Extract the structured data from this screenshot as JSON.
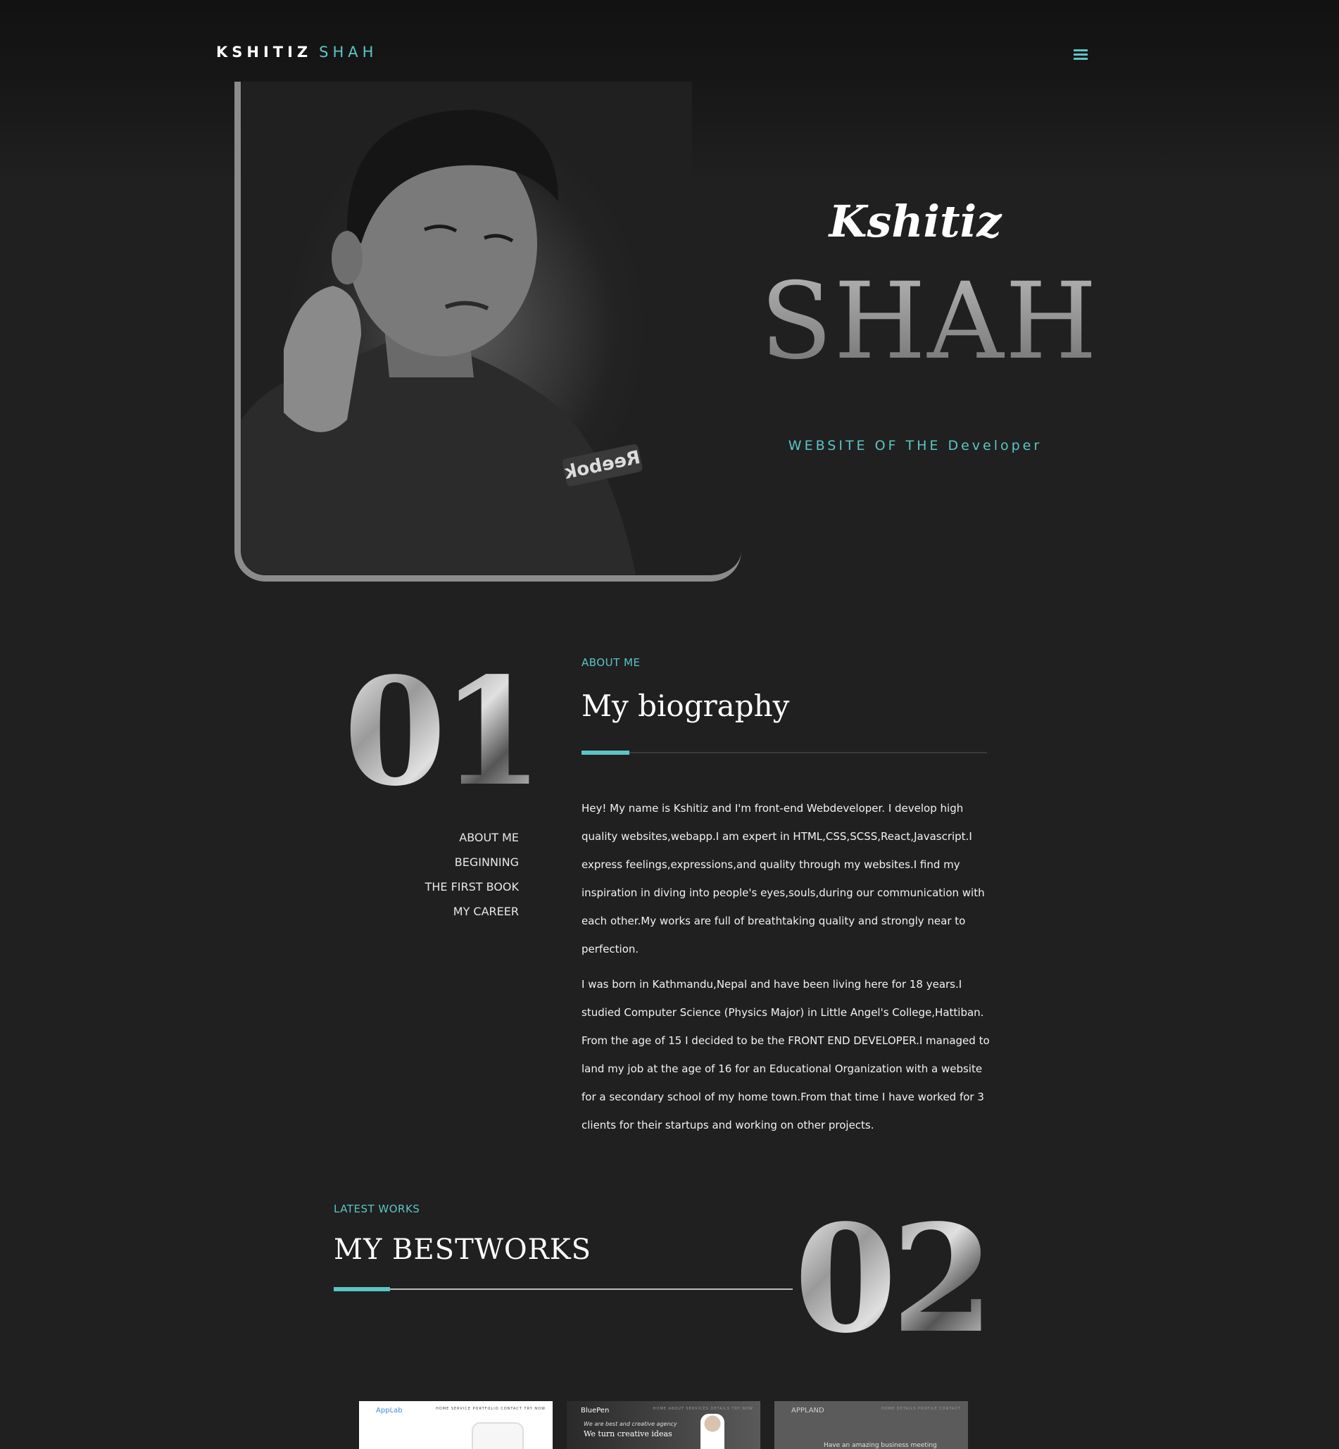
{
  "header": {
    "logo_first": "KSHITIZ",
    "logo_last": "SHAH",
    "menu_icon": "hamburger-menu-icon"
  },
  "hero": {
    "first_name": "Kshitiz",
    "last_name": "SHAH",
    "subtitle": "WEBSITE OF THE Developer",
    "photo_sleeve_text": "Reebok"
  },
  "about": {
    "number": "01",
    "eyebrow": "ABOUT ME",
    "title": "My biography",
    "nav": [
      "ABOUT ME",
      "BEGINNING",
      "THE FIRST BOOK",
      "MY CAREER"
    ],
    "paragraphs": [
      "Hey! My name is Kshitiz and I'm front-end Webdeveloper. I develop high quality websites,webapp.I am expert in HTML,CSS,SCSS,React,Javascript.I express feelings,expressions,and quality through my websites.I find my inspiration in diving into people's eyes,souls,during our communication with each other.My works are full of breathtaking quality and strongly near to perfection.",
      "I was born in Kathmandu,Nepal and have been living here for 18 years.I studied Computer Science (Physics Major) in Little Angel's College,Hattiban. From the age of 15 I decided to be the FRONT END DEVELOPER.I managed to land my job at the age of 16 for an Educational Organization with a website for a secondary school of my home town.From that time I have worked for 3 clients for their startups and working on other projects."
    ]
  },
  "works": {
    "number": "02",
    "eyebrow": "LATEST WORKS",
    "title": "MY BESTWORKS",
    "thumbnails": [
      {
        "brand": "AppLab",
        "nav": "HOME  SERVICE  PORTFOLIO  CONTACT  TRY NOW"
      },
      {
        "brand": "BluePen",
        "nav": "HOME  ABOUT  SERVICES  DETAILS  TRY NOW",
        "tagline": "We are best and creative agency",
        "headline": "We turn creative ideas"
      },
      {
        "brand": "APPLAND",
        "nav": "HOME  DETAILS  PROFILE  CONTACT",
        "headline": "Have an amazing business meeting"
      }
    ]
  },
  "colors": {
    "accent": "#5cc5c4",
    "background": "#202020"
  }
}
